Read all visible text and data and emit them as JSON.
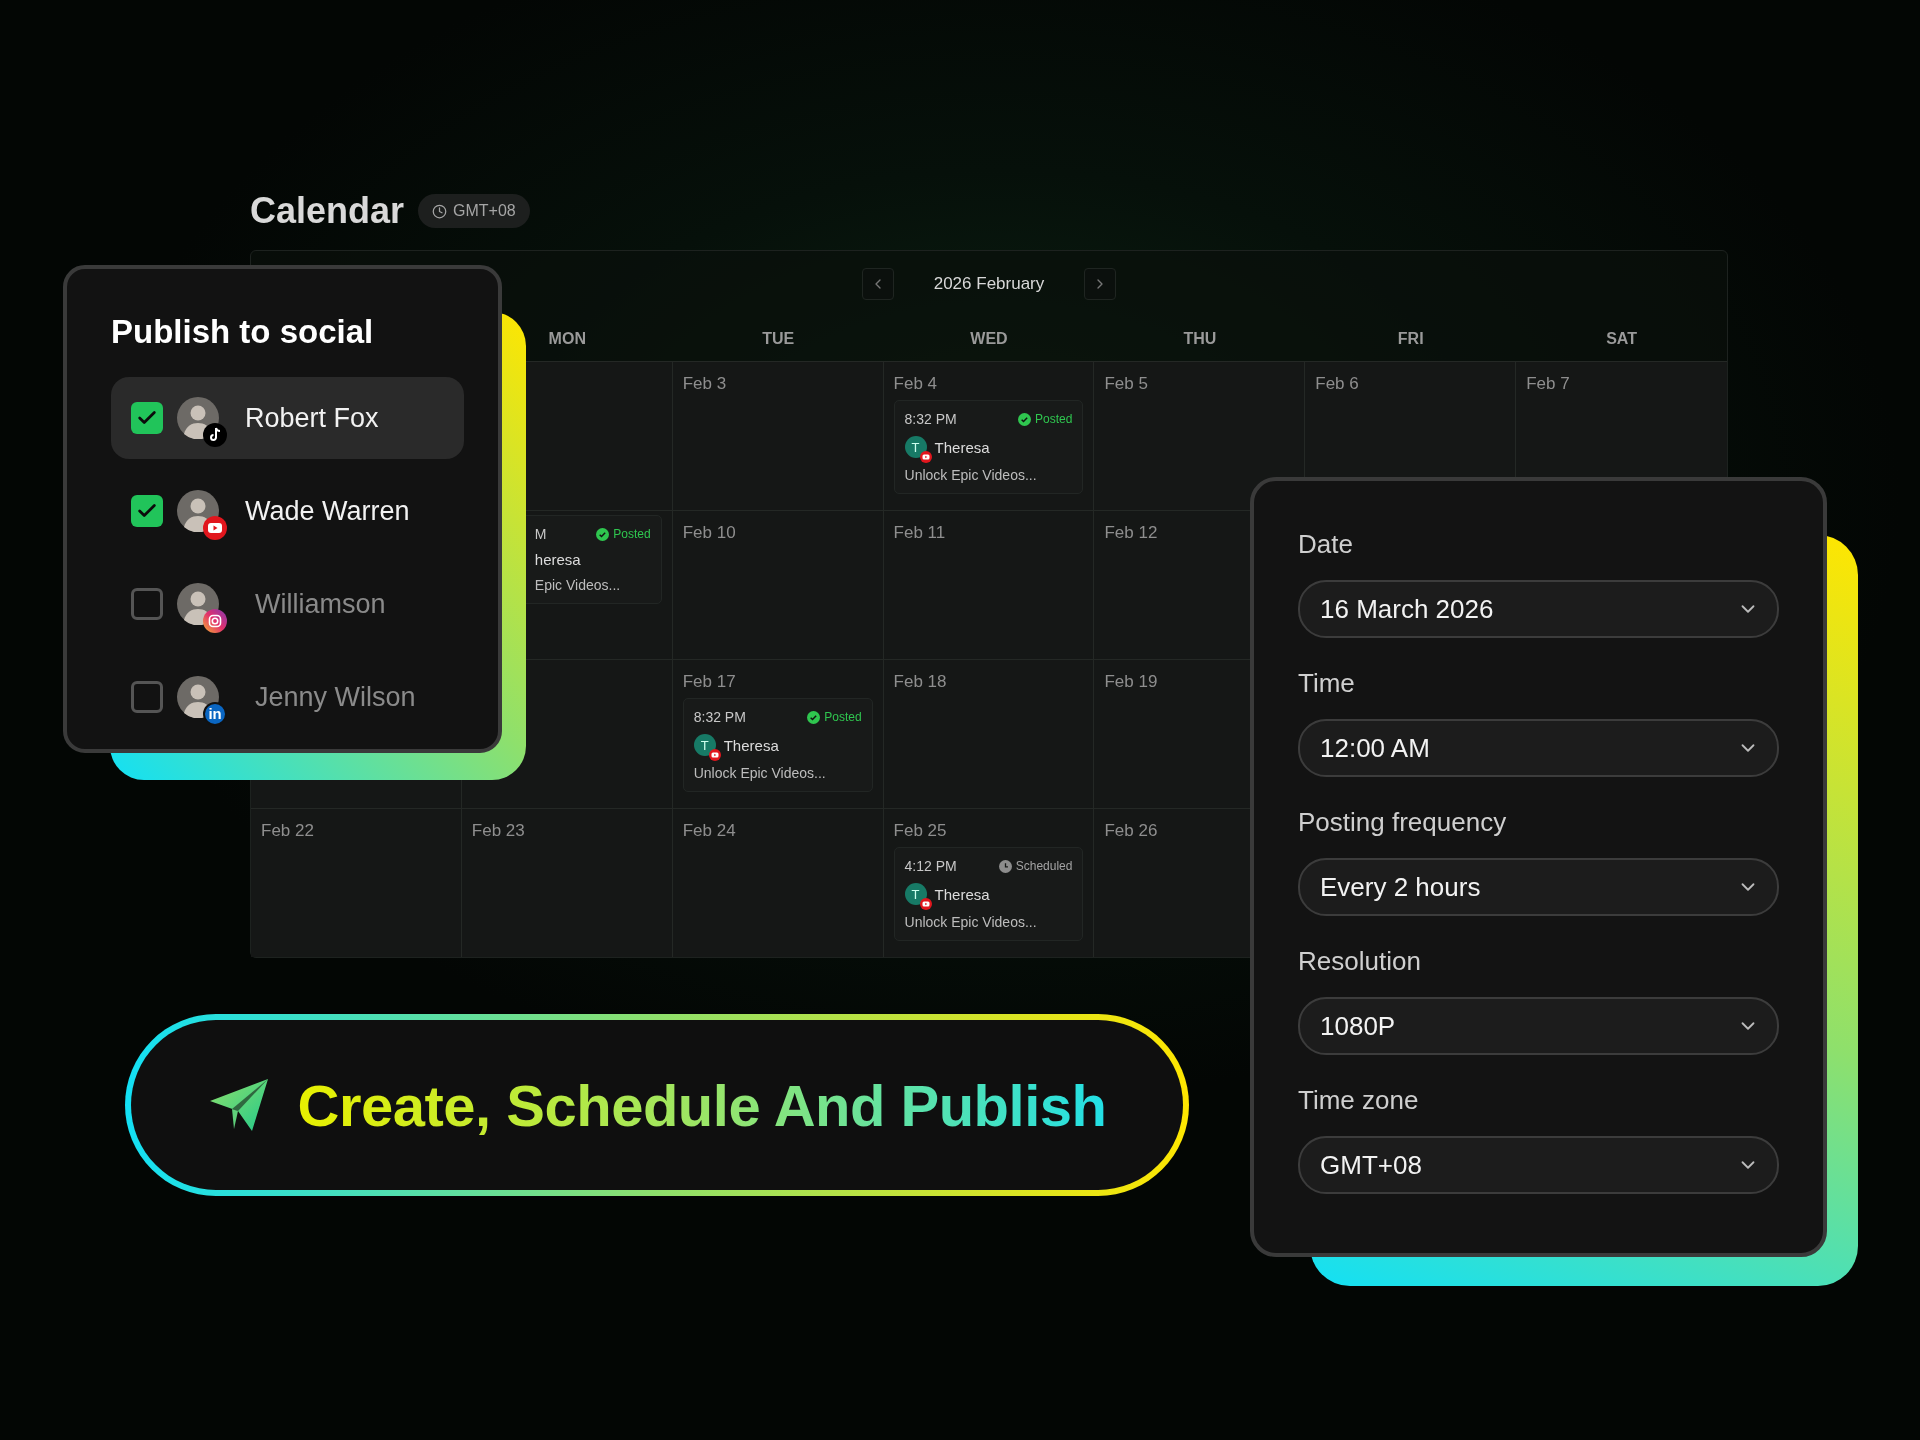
{
  "calendar": {
    "title": "Calendar",
    "timezone": "GMT+08",
    "month": "2026 February",
    "weekdays": [
      {
        "label": "MON"
      },
      {
        "label": "TUE"
      },
      {
        "label": "WED"
      },
      {
        "label": "THU"
      },
      {
        "label": "FRI"
      },
      {
        "label": "SAT"
      }
    ],
    "weeks": [
      {
        "mon": {
          "kind": "empty"
        },
        "tue": {
          "date": "Feb 3"
        },
        "wed": {
          "date": "Feb 4",
          "events": [
            {
              "kind": "full",
              "time": "8:32 PM",
              "status": "Posted",
              "posted": true,
              "initial": "T",
              "author": "Theresa",
              "title": "Unlock Epic Videos..."
            }
          ]
        },
        "thu": {
          "date": "Feb 5"
        },
        "fri": {
          "date": "Feb 6"
        },
        "sat": {
          "date": "Feb 7"
        }
      },
      {
        "mon": {
          "events": [
            {
              "kind": "partial",
              "time": "M",
              "status": "Posted",
              "posted": true,
              "author": "heresa",
              "title": "Epic Videos..."
            }
          ]
        },
        "tue": {
          "date": "Feb 10"
        },
        "wed": {
          "date": "Feb 11"
        },
        "thu": {
          "date": "Feb 12"
        }
      },
      {
        "sun": {
          "kind": "empty"
        },
        "mon": {
          "kind": "empty"
        },
        "tue": {
          "date": "Feb 17",
          "events": [
            {
              "kind": "full",
              "time": "8:32 PM",
              "status": "Posted",
              "posted": true,
              "initial": "T",
              "author": "Theresa",
              "title": "Unlock Epic Videos..."
            }
          ]
        },
        "wed": {
          "date": "Feb 18"
        },
        "thu": {
          "date": "Feb 19"
        }
      },
      {
        "sun": {
          "date": "Feb 22"
        },
        "mon": {
          "date": "Feb 23"
        },
        "tue": {
          "date": "Feb 24"
        },
        "wed": {
          "date": "Feb 25",
          "events": [
            {
              "kind": "full",
              "time": "4:12 PM",
              "status": "Scheduled",
              "posted": false,
              "initial": "T",
              "author": "Theresa",
              "title": "Unlock Epic Videos..."
            }
          ]
        },
        "thu": {
          "date": "Feb 26"
        }
      }
    ]
  },
  "publish": {
    "title": "Publish to social",
    "accounts": [
      {
        "name": "Robert Fox",
        "checked": true,
        "highlighted": true,
        "kind": "tiktok"
      },
      {
        "name": "Wade Warren",
        "checked": true,
        "highlighted": false,
        "kind": "youtube"
      },
      {
        "name": "Williamson",
        "checked": false,
        "highlighted": false,
        "kind": "instagram"
      },
      {
        "name": "Jenny Wilson",
        "checked": false,
        "highlighted": false,
        "kind": "linkedin",
        "badge_text": "in"
      }
    ]
  },
  "settings": {
    "fields": [
      {
        "label": "Date",
        "value": "16 March 2026"
      },
      {
        "label": "Time",
        "value": "12:00 AM"
      },
      {
        "label": "Posting frequency",
        "value": "Every 2 hours"
      },
      {
        "label": "Resolution",
        "value": "1080P"
      },
      {
        "label": "Time zone",
        "value": "GMT+08"
      }
    ]
  },
  "banner": {
    "text": "Create, Schedule And Publish"
  }
}
